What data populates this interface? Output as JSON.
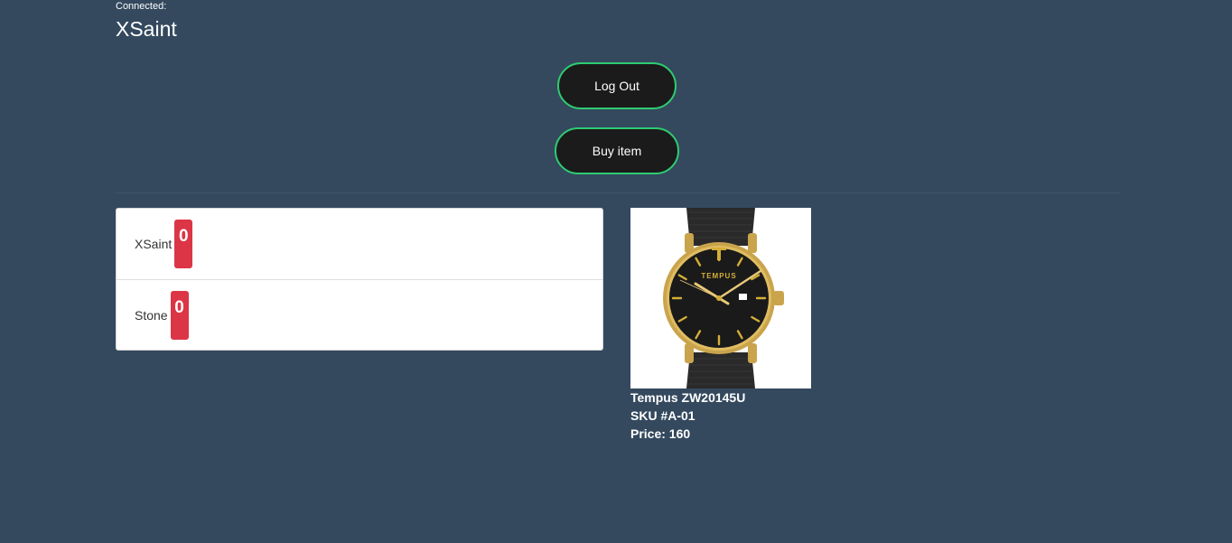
{
  "header": {
    "connected_label": "Connected:",
    "username": "XSaint"
  },
  "actions": {
    "logout_label": "Log Out",
    "buy_label": "Buy item"
  },
  "players": [
    {
      "name": "XSaint",
      "score": "0"
    },
    {
      "name": "Stone",
      "score": "0"
    }
  ],
  "product": {
    "name": "Tempus ZW20145U",
    "sku": "SKU #A-01",
    "price": "Price: 160",
    "image_icon": "watch-image",
    "brand_mark": "TEMPUS"
  },
  "colors": {
    "background": "#34495e",
    "button_border": "#2ecc71",
    "button_bg": "#1b1b1b",
    "badge": "#dc3545"
  }
}
